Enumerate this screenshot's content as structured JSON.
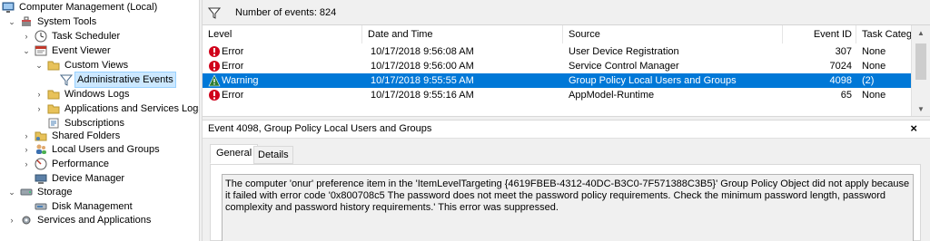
{
  "tree": {
    "items": [
      {
        "label": "Computer Management (Local)",
        "icon": "computer-management-icon",
        "expander": ""
      },
      {
        "label": "System Tools",
        "icon": "system-tools-icon",
        "expander": "⌄"
      },
      {
        "label": "Task Scheduler",
        "icon": "task-scheduler-icon",
        "expander": "›"
      },
      {
        "label": "Event Viewer",
        "icon": "event-viewer-icon",
        "expander": "⌄"
      },
      {
        "label": "Custom Views",
        "icon": "folder-icon",
        "expander": "⌄"
      },
      {
        "label": "Administrative Events",
        "icon": "filter-icon",
        "expander": ""
      },
      {
        "label": "Windows Logs",
        "icon": "folder-icon",
        "expander": "›"
      },
      {
        "label": "Applications and Services Logs",
        "icon": "folder-icon",
        "expander": "›"
      },
      {
        "label": "Subscriptions",
        "icon": "subscriptions-icon",
        "expander": ""
      },
      {
        "label": "Shared Folders",
        "icon": "shared-folder-icon",
        "expander": "›"
      },
      {
        "label": "Local Users and Groups",
        "icon": "users-icon",
        "expander": "›"
      },
      {
        "label": "Performance",
        "icon": "performance-icon",
        "expander": "›"
      },
      {
        "label": "Device Manager",
        "icon": "device-manager-icon",
        "expander": ""
      },
      {
        "label": "Storage",
        "icon": "storage-icon",
        "expander": "⌄"
      },
      {
        "label": "Disk Management",
        "icon": "disk-icon",
        "expander": ""
      },
      {
        "label": "Services and Applications",
        "icon": "services-icon",
        "expander": "›"
      }
    ]
  },
  "filterbar": {
    "text": "Number of events: 824"
  },
  "grid": {
    "columns": [
      "Level",
      "Date and Time",
      "Source",
      "Event ID",
      "Task Catego"
    ],
    "rows": [
      {
        "level": "Error",
        "datetime": "10/17/2018 9:56:08 AM",
        "source": "User Device Registration",
        "event_id": "307",
        "task": "None",
        "icon": "error-icon"
      },
      {
        "level": "Error",
        "datetime": "10/17/2018 9:56:00 AM",
        "source": "Service Control Manager",
        "event_id": "7024",
        "task": "None",
        "icon": "error-icon"
      },
      {
        "level": "Warning",
        "datetime": "10/17/2018 9:55:55 AM",
        "source": "Group Policy Local Users and Groups",
        "event_id": "4098",
        "task": "(2)",
        "icon": "warning-icon"
      },
      {
        "level": "Error",
        "datetime": "10/17/2018 9:55:16 AM",
        "source": "AppModel-Runtime",
        "event_id": "65",
        "task": "None",
        "icon": "error-icon"
      }
    ]
  },
  "detail": {
    "title": "Event 4098, Group Policy Local Users and Groups",
    "close": "×",
    "tabs": [
      "General",
      "Details"
    ],
    "message": "The computer 'onur' preference item in the 'ItemLevelTargeting {4619FBEB-4312-40DC-B3C0-7F571388C3B5}' Group Policy Object did not apply because it failed with error code '0x800708c5 The password does not meet the password policy requirements. Check the minimum password length, password complexity and password history requirements.' This error was suppressed."
  },
  "colors": {
    "selection": "#0078d7",
    "tree_selection": "#cce8ff",
    "error": "#d0021b",
    "warning": "#2e7d32"
  }
}
